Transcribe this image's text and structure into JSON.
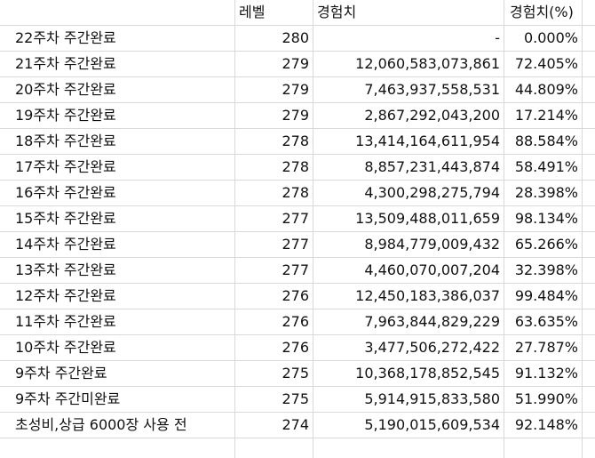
{
  "header": {
    "col0": "",
    "col1": "레벨",
    "col2": "경험치",
    "col3": "경험치(%)"
  },
  "rows": [
    {
      "label": "22주차 주간완료",
      "level": "280",
      "exp": "-",
      "pct": "0.000%"
    },
    {
      "label": "21주차 주간완료",
      "level": "279",
      "exp": "12,060,583,073,861",
      "pct": "72.405%"
    },
    {
      "label": "20주차 주간완료",
      "level": "279",
      "exp": "7,463,937,558,531",
      "pct": "44.809%"
    },
    {
      "label": "19주차 주간완료",
      "level": "279",
      "exp": "2,867,292,043,200",
      "pct": "17.214%"
    },
    {
      "label": "18주차 주간완료",
      "level": "278",
      "exp": "13,414,164,611,954",
      "pct": "88.584%"
    },
    {
      "label": "17주차 주간완료",
      "level": "278",
      "exp": "8,857,231,443,874",
      "pct": "58.491%"
    },
    {
      "label": "16주차 주간완료",
      "level": "278",
      "exp": "4,300,298,275,794",
      "pct": "28.398%"
    },
    {
      "label": "15주차 주간완료",
      "level": "277",
      "exp": "13,509,488,011,659",
      "pct": "98.134%"
    },
    {
      "label": "14주차 주간완료",
      "level": "277",
      "exp": "8,984,779,009,432",
      "pct": "65.266%"
    },
    {
      "label": "13주차 주간완료",
      "level": "277",
      "exp": "4,460,070,007,204",
      "pct": "32.398%"
    },
    {
      "label": "12주차 주간완료",
      "level": "276",
      "exp": "12,450,183,386,037",
      "pct": "99.484%"
    },
    {
      "label": "11주차 주간완료",
      "level": "276",
      "exp": "7,963,844,829,229",
      "pct": "63.635%"
    },
    {
      "label": "10주차 주간완료",
      "level": "276",
      "exp": "3,477,506,272,422",
      "pct": "27.787%"
    },
    {
      "label": "9주차 주간완료",
      "level": "275",
      "exp": "10,368,178,852,545",
      "pct": "91.132%"
    },
    {
      "label": "9주차 주간미완료",
      "level": "275",
      "exp": "5,914,915,833,580",
      "pct": "51.990%"
    },
    {
      "label": "초성비,상급 6000장 사용 전",
      "level": "274",
      "exp": "5,190,015,609,534",
      "pct": "92.148%"
    }
  ]
}
